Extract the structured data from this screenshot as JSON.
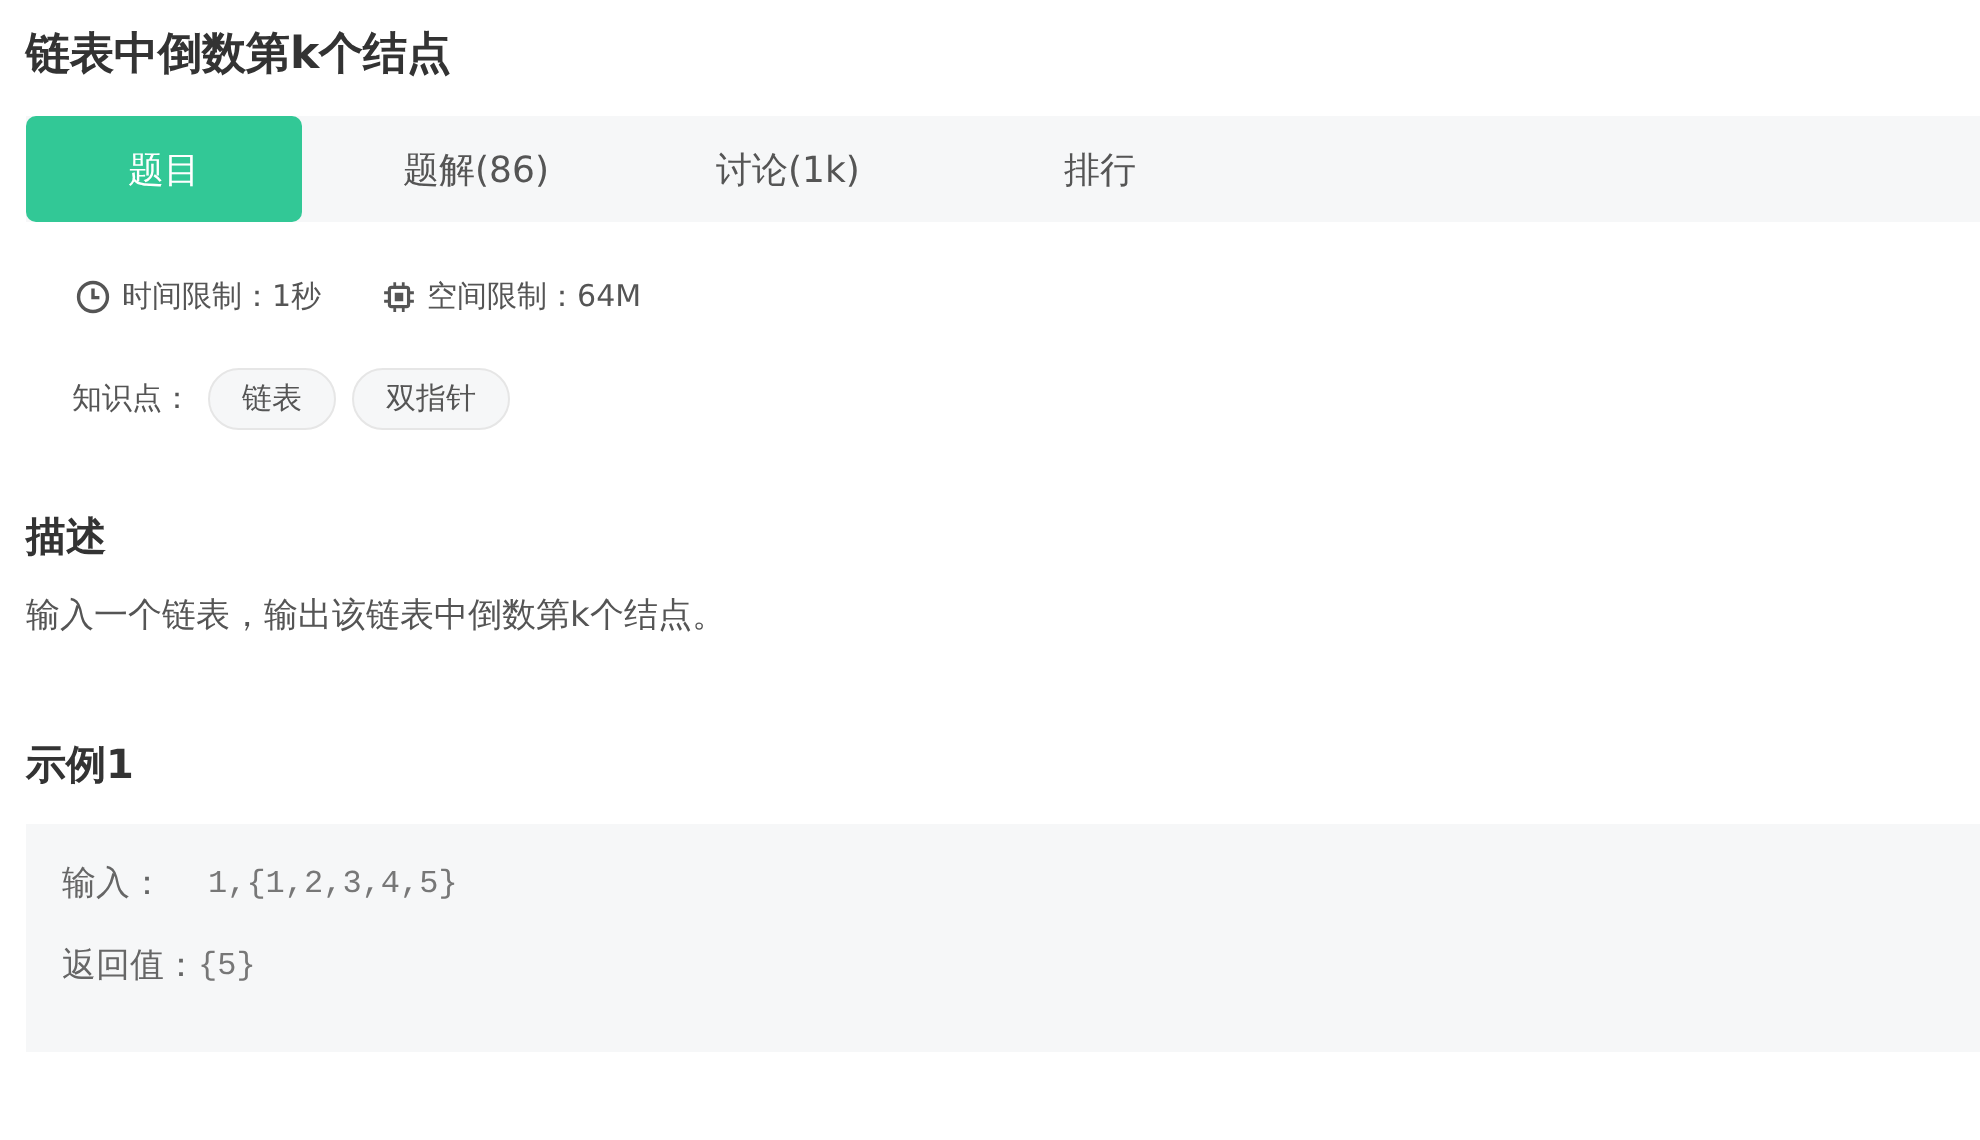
{
  "title": "链表中倒数第k个结点",
  "tabs": [
    {
      "label": "题目",
      "selected": true
    },
    {
      "label": "题解(86)",
      "selected": false
    },
    {
      "label": "讨论(1k)",
      "selected": false
    },
    {
      "label": "排行",
      "selected": false
    }
  ],
  "limits": [
    {
      "kind": "time",
      "text": "时间限制：1秒"
    },
    {
      "kind": "memory",
      "text": "空间限制：64M"
    }
  ],
  "knowledge": {
    "label": "知识点：",
    "tags": [
      "链表",
      "双指针"
    ]
  },
  "description": {
    "heading": "描述",
    "text": "输入一个链表，输出该链表中倒数第k个结点。"
  },
  "example": {
    "heading": "示例1",
    "rows": [
      {
        "label": "输入：",
        "value": "1,{1,2,3,4,5}"
      },
      {
        "label": "返回值：",
        "value": "{5}"
      }
    ]
  }
}
